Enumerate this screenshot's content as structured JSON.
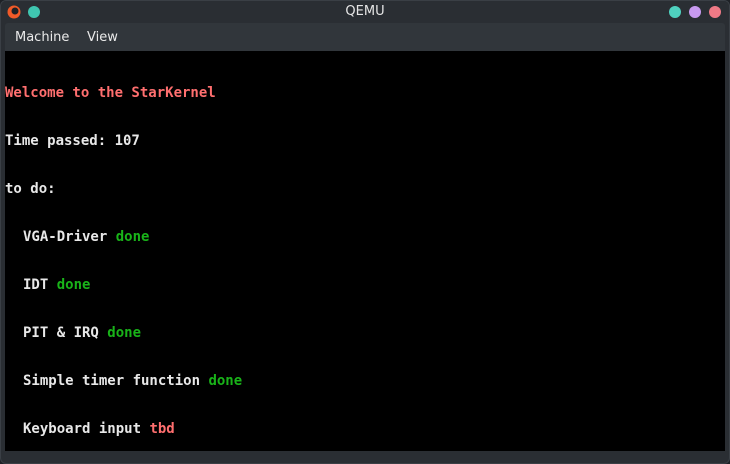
{
  "window": {
    "title": "QEMU"
  },
  "colors": {
    "pin_button": "#3fc6b0",
    "minimize_button": "#4fd1bf",
    "maximize_button": "#c89af0",
    "close_button": "#f07a86",
    "icon_primary": "#f05a28",
    "console_text": "#e8e8e8",
    "console_red": "#ff6f6f",
    "console_green": "#19b319"
  },
  "icons": {
    "app": "qemu-icon",
    "pin": "pin-icon",
    "minimize": "minimize-icon",
    "maximize": "maximize-icon",
    "close": "close-icon"
  },
  "menu": {
    "items": [
      "Machine",
      "View"
    ]
  },
  "console": {
    "welcome": "Welcome to the StarKernel",
    "time_label": "Time passed: ",
    "time_value": "107",
    "todo_heading": "to do:",
    "tasks": [
      {
        "name": "VGA-Driver",
        "status": "done"
      },
      {
        "name": "IDT",
        "status": "done"
      },
      {
        "name": "PIT & IRQ",
        "status": "done"
      },
      {
        "name": "Simple timer function",
        "status": "done"
      },
      {
        "name": "Keyboard input",
        "status": "tbd"
      }
    ]
  }
}
